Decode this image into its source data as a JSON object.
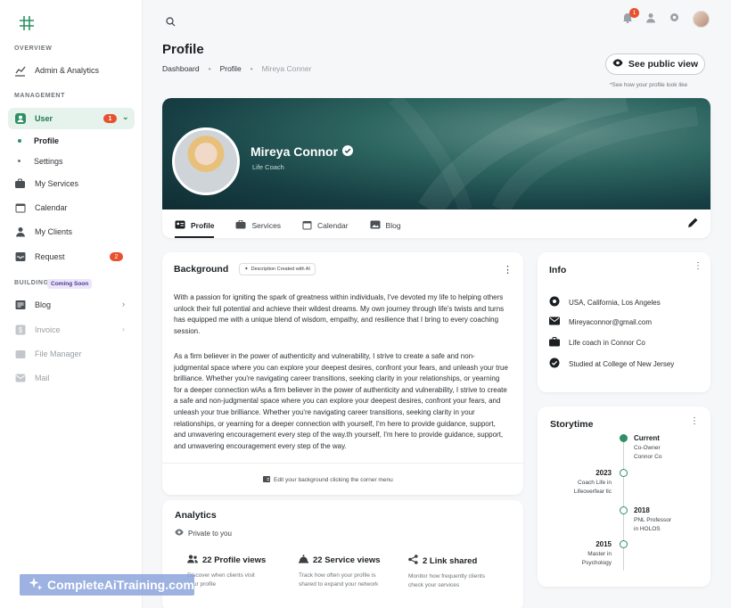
{
  "sidebar": {
    "overview_label": "OVERVIEW",
    "management_label": "MANAGEMENT",
    "building_label": "BUILDING",
    "coming_soon": "Coming Soon",
    "items": {
      "admin": "Admin & Analytics",
      "user": "User",
      "user_badge": "1",
      "profile": "Profile",
      "settings": "Settings",
      "services": "My Services",
      "calendar": "Calendar",
      "clients": "My Clients",
      "request": "Request",
      "request_badge": "2",
      "blog": "Blog",
      "invoice": "Invoice",
      "file_manager": "File Manager",
      "mail": "Mail"
    }
  },
  "topbar": {
    "notification_count": "1"
  },
  "header": {
    "title": "Profile",
    "breadcrumb": [
      "Dashboard",
      "Profile",
      "Mireya Conner"
    ],
    "public_button": "See public view",
    "public_note": "*See how your profile look like"
  },
  "profile": {
    "name": "Mireya Connor",
    "role": "Life Coach",
    "tabs": [
      "Profile",
      "Services",
      "Calendar",
      "Blog"
    ]
  },
  "background": {
    "title": "Background",
    "ai_chip": "Description Created  with AI",
    "para1": "With a passion for igniting the spark of greatness within individuals, I've devoted my life to helping others unlock their full potential and achieve their wildest dreams. My own journey through life's twists and turns has equipped me with a unique blend of wisdom, empathy, and resilience that I bring to every coaching session.",
    "para2": "As a firm believer in the power of authenticity and vulnerability, I strive to create a safe and non-judgmental space where you can explore your deepest desires, confront your fears, and unleash your true brilliance. Whether you're navigating career transitions, seeking clarity in your relationships, or yearning for a deeper connection wiAs a firm believer in the power of authenticity and vulnerability, I strive to create a safe and non-judgmental space where you can explore your deepest desires, confront your fears, and unleash your true brilliance. Whether you're navigating career transitions, seeking clarity in your relationships, or yearning for a deeper connection with yourself, I'm here to provide guidance, support, and unwavering encouragement every step of the way.th yourself, I'm here to provide guidance, support, and unwavering encouragement every step of the way.",
    "footer": "Edit your background clicking the corner menu"
  },
  "info": {
    "title": "Info",
    "location": "USA, California, Los Angeles",
    "email": "Mireyaconnor@gmail.com",
    "job": "Life coach in Connor Co",
    "study": "Studied at College of New Jersey"
  },
  "storytime": {
    "title": "Storytime",
    "entries": [
      {
        "year": "Current",
        "desc": [
          "Co-Owner",
          "Connor Co"
        ]
      },
      {
        "year": "2023",
        "desc": [
          "Coach Life in",
          "Lifeoverfear llc"
        ]
      },
      {
        "year": "2018",
        "desc": [
          "PNL  Professor",
          "in HOLOS"
        ]
      },
      {
        "year": "2015",
        "desc": [
          "Master in",
          "Psychology"
        ]
      }
    ]
  },
  "analytics": {
    "title": "Analytics",
    "privacy": "Private to you",
    "stats": [
      {
        "title": "22 Profile views",
        "desc": [
          "Discover when clients visit",
          "your profile"
        ]
      },
      {
        "title": "22 Service views",
        "desc": [
          "Track how often your profile is",
          "shared to expand your network"
        ]
      },
      {
        "title": "2 Link shared",
        "desc": [
          "Monitor how frequently clients",
          "check your services"
        ]
      }
    ]
  },
  "watermark": "CompleteAiTraining.com",
  "colors": {
    "accent_green": "#2e8f63",
    "badge_red": "#e8512f",
    "banner_teal": "#1f4f52"
  }
}
